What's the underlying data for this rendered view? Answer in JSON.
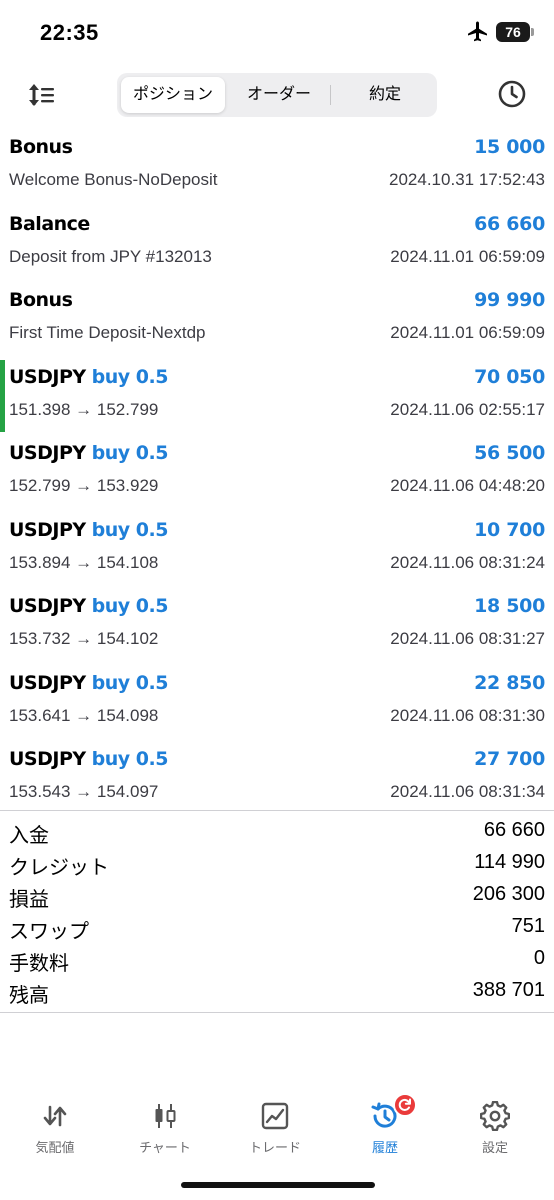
{
  "status": {
    "time": "22:35",
    "battery": "76"
  },
  "tabs": [
    {
      "label": "ポジション",
      "active": true
    },
    {
      "label": "オーダー",
      "active": false
    },
    {
      "label": "約定",
      "active": false
    }
  ],
  "deals": [
    {
      "title": "Bonus",
      "side": "",
      "profit": "15 000",
      "subtitle": "Welcome Bonus-NoDeposit",
      "time": "2024.10.31 17:52:43"
    },
    {
      "title": "Balance",
      "side": "",
      "profit": "66 660",
      "subtitle": "Deposit from JPY #132013",
      "time": "2024.11.01 06:59:09"
    },
    {
      "title": "Bonus",
      "side": "",
      "profit": "99 990",
      "subtitle": "First Time Deposit-Nextdp",
      "time": "2024.11.01 06:59:09"
    },
    {
      "title": "USDJPY",
      "side": "buy 0.5",
      "profit": "70 050",
      "subtitle": "151.398 → 152.799",
      "time": "2024.11.06 02:55:17"
    },
    {
      "title": "USDJPY",
      "side": "buy 0.5",
      "profit": "56 500",
      "subtitle": "152.799 → 153.929",
      "time": "2024.11.06 04:48:20"
    },
    {
      "title": "USDJPY",
      "side": "buy 0.5",
      "profit": "10 700",
      "subtitle": "153.894 → 154.108",
      "time": "2024.11.06 08:31:24"
    },
    {
      "title": "USDJPY",
      "side": "buy 0.5",
      "profit": "18 500",
      "subtitle": "153.732 → 154.102",
      "time": "2024.11.06 08:31:27"
    },
    {
      "title": "USDJPY",
      "side": "buy 0.5",
      "profit": "22 850",
      "subtitle": "153.641 → 154.098",
      "time": "2024.11.06 08:31:30"
    },
    {
      "title": "USDJPY",
      "side": "buy 0.5",
      "profit": "27 700",
      "subtitle": "153.543 → 154.097",
      "time": "2024.11.06 08:31:34"
    }
  ],
  "summary": [
    {
      "label": "入金",
      "value": "66 660"
    },
    {
      "label": "クレジット",
      "value": "114 990"
    },
    {
      "label": "損益",
      "value": "206 300"
    },
    {
      "label": "スワップ",
      "value": "751"
    },
    {
      "label": "手数料",
      "value": "0"
    },
    {
      "label": "残高",
      "value": "388 701"
    }
  ],
  "bottom_nav": [
    {
      "label": "気配値",
      "icon": "quotes-arrows-icon",
      "active": false
    },
    {
      "label": "チャート",
      "icon": "candlestick-chart-icon",
      "active": false
    },
    {
      "label": "トレード",
      "icon": "trade-chart-icon",
      "active": false
    },
    {
      "label": "履歴",
      "icon": "history-icon",
      "active": true
    },
    {
      "label": "設定",
      "icon": "gear-icon",
      "active": false
    }
  ],
  "colors": {
    "accent": "#1f7fd8",
    "buy_marker": "#25a244",
    "badge": "#ea3b3b"
  }
}
